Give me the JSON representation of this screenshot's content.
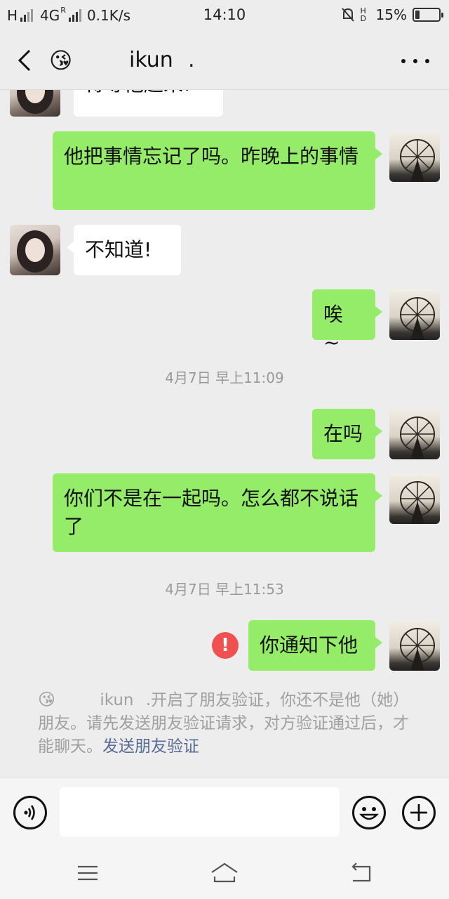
{
  "status_bar": {
    "carrier": "H",
    "network": "4G",
    "roaming": "R",
    "speed": "0.1K/s",
    "time": "14:10",
    "hd": "HD",
    "battery": "15%"
  },
  "header": {
    "title": "ikun",
    "title_suffix": ".",
    "contact_emoji": "😘"
  },
  "messages": [
    {
      "side": "left",
      "text": "得等他起来!"
    },
    {
      "side": "right",
      "text": "他把事情忘记了吗。昨晚上的事情"
    },
    {
      "side": "left",
      "text": "不知道!"
    },
    {
      "side": "right",
      "text": "唉 ~"
    },
    {
      "side": "right",
      "text": "在吗"
    },
    {
      "side": "right",
      "text": "你们不是在一起吗。怎么都不说话了"
    },
    {
      "side": "right",
      "text": "你通知下他",
      "status": "failed"
    }
  ],
  "timestamps": [
    "4月7日 早上11:09",
    "4月7日 早上11:53"
  ],
  "error_mark": "!",
  "notice": {
    "emoji": "😘",
    "name": "ikun",
    "text": ".开启了朋友验证，你还不是他（她）朋友。请先发送朋友验证请求，对方验证通过后，才能聊天。",
    "link": "发送朋友验证"
  },
  "colors": {
    "sent_bubble": "#95ec69",
    "received_bubble": "#ffffff",
    "background": "#ededed",
    "error": "#f05050",
    "link": "#576b95"
  }
}
